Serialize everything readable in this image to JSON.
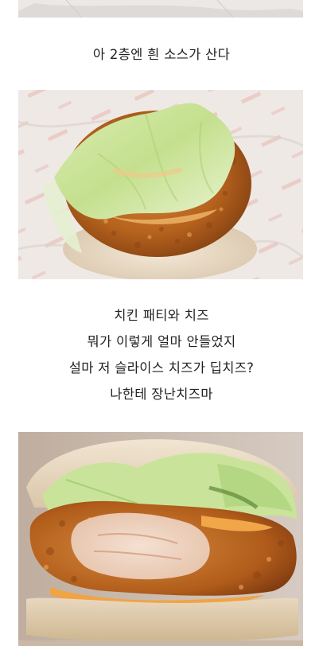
{
  "captions": {
    "first": "아 2층엔 흰 소스가 산다",
    "second": [
      "치킨 패티와 치즈",
      "뭐가 이렇게 얼마 안들었지",
      "설마 저 슬라이스 치즈가 딥치즈?",
      "나한테 장난치즈마"
    ]
  },
  "photos": {
    "top": "bun-top-on-wrapper-photo",
    "first": "chicken-patty-lettuce-on-wrapper-photo",
    "second": "burger-cross-section-closeup-photo"
  }
}
